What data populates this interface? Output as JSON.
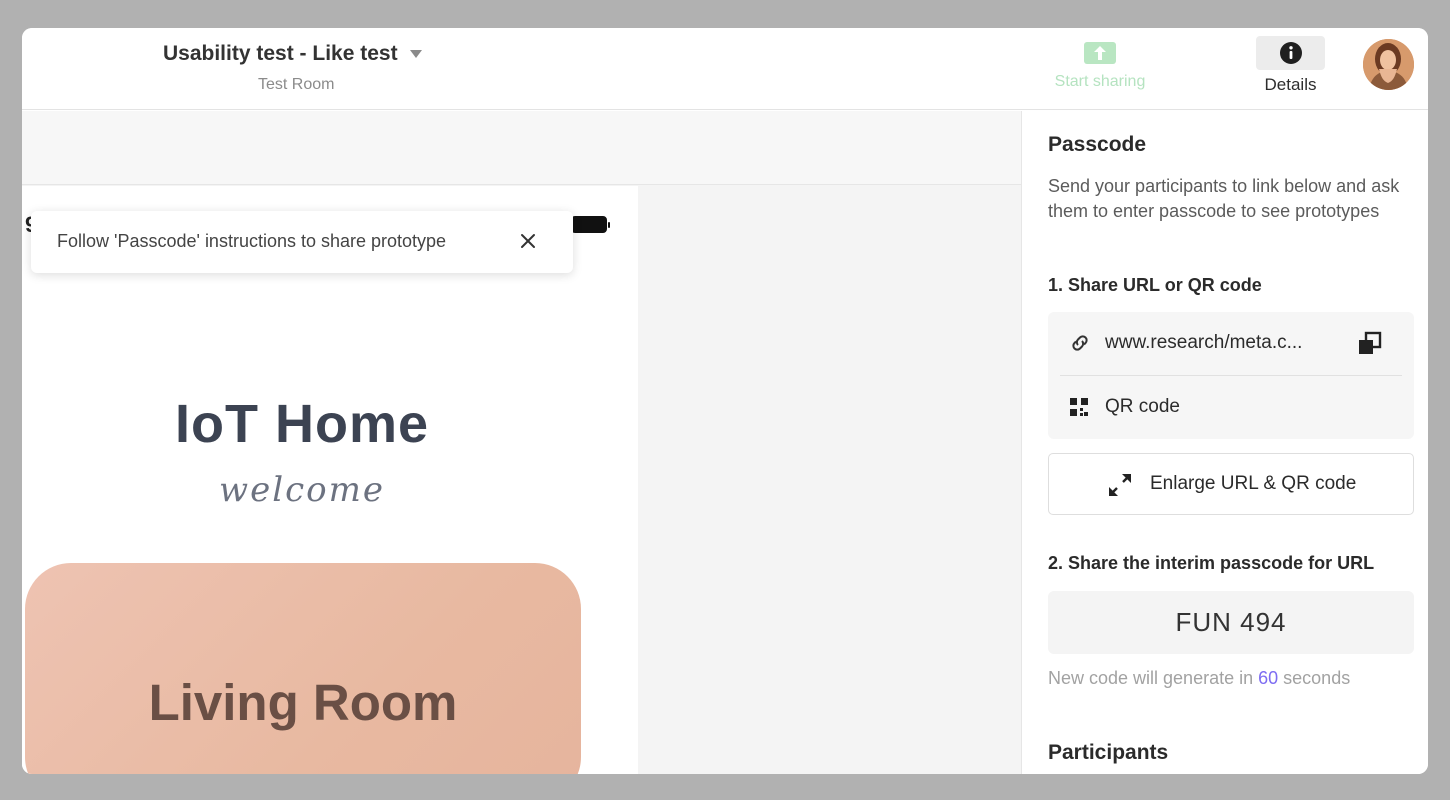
{
  "header": {
    "title": "Usability test - Like test",
    "subtitle": "Test Room",
    "share_label": "Start sharing",
    "details_label": "Details"
  },
  "prototype": {
    "status_bar_fragment": "9",
    "app_title": "IoT Home",
    "app_subtitle": "welcome",
    "room_card_title": "Living Room"
  },
  "toast": {
    "message": "Follow 'Passcode' instructions to share prototype"
  },
  "panel": {
    "title": "Passcode",
    "description": "Send your participants to link below and ask them to enter passcode to see prototypes",
    "step1_label": "1. Share URL or QR code",
    "url": "www.research/meta.c...",
    "qr_label": "QR code",
    "enlarge_label": "Enlarge URL & QR code",
    "step2_label": "2. Share the interim passcode for URL",
    "passcode": "FUN 494",
    "timer_prefix": "New code will generate in ",
    "timer_seconds": "60",
    "timer_suffix": " seconds",
    "participants_label": "Participants"
  },
  "colors": {
    "share_disabled": "#b5e3c0",
    "accent_timer": "#7d6cf2",
    "room_card": "#e8b9a1"
  }
}
